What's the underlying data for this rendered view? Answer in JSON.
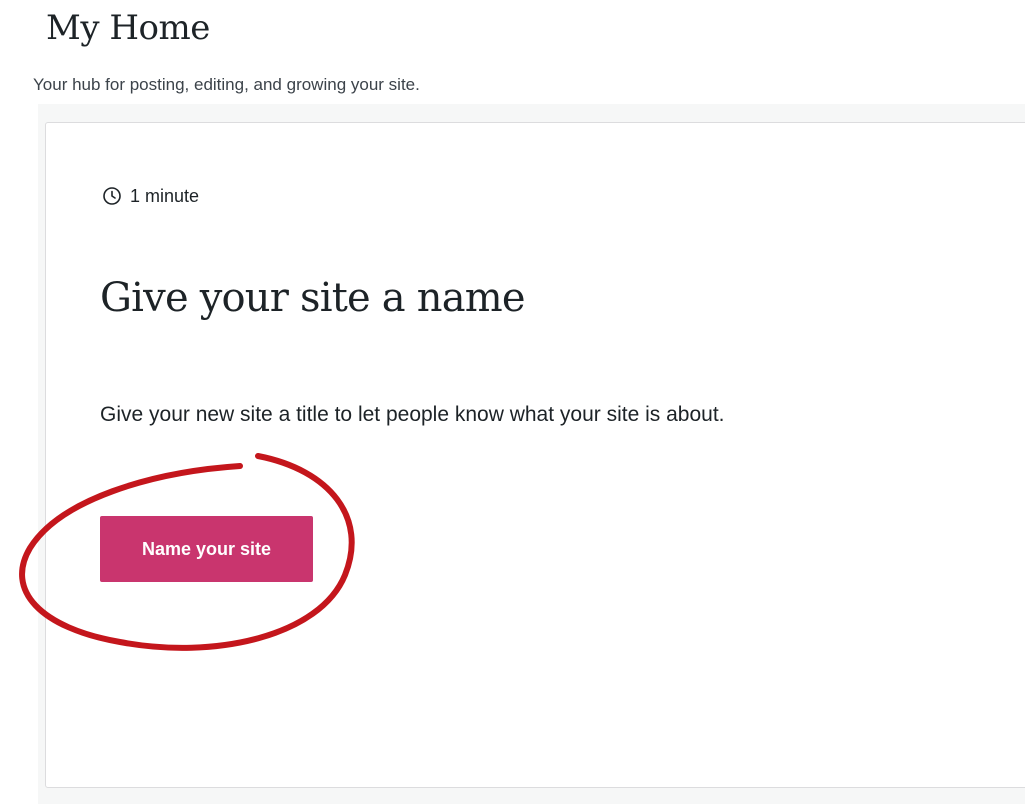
{
  "header": {
    "title": "My Home",
    "subtitle": "Your hub for posting, editing, and growing your site."
  },
  "task_card": {
    "time_icon": "clock-icon",
    "time_estimate": "1 minute",
    "title": "Give your site a name",
    "description": "Give your new site a title to let people know what your site is about.",
    "button_label": "Name your site"
  },
  "colors": {
    "button_background": "#c9356e",
    "annotation_circle": "#c4161c"
  }
}
